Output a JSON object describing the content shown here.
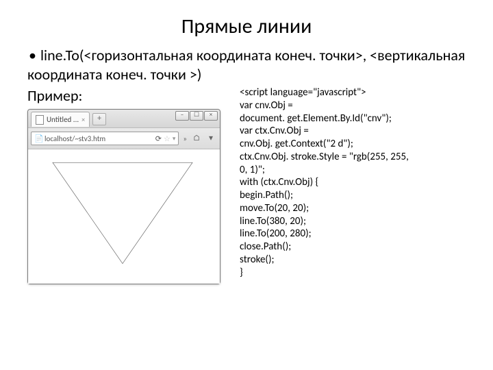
{
  "title": "Прямые линии",
  "bullet_text": "line.To(<горизонтальная координата конеч. точки>, <вертикальная координата конеч. точки >)",
  "example_label": "Пример:",
  "browser": {
    "tab_title": "Untitled ...",
    "tab_close": "×",
    "newtab": "+",
    "win_min": "–",
    "win_max": "☐",
    "win_close": "×",
    "url": "localhost/~stv3.htm",
    "reload": "⟳",
    "star": "☆",
    "hist": "▾",
    "chevrons": "»",
    "home": "⌂",
    "nav_down": "▾"
  },
  "code": {
    "l1": "<script language=\"javascript\">",
    "l2": "var cnv.Obj =",
    "l3": "document. get.Element.By.Id(\"cnv\");",
    "l4": "var ctx.Cnv.Obj =",
    "l5": "cnv.Obj. get.Context(\"2 d\");",
    "l6": "ctx.Cnv.Obj. stroke.Style = \"rgb(255, 255,",
    "l7": "0, 1)\";",
    "l8": "with (ctx.Cnv.Obj) {",
    "l9": "begin.Path();",
    "l10": "move.To(20, 20);",
    "l11": "line.To(380, 20);",
    "l12": "line.To(200, 280);",
    "l13": "close.Path();",
    "l14": "stroke();",
    "l15": "}"
  }
}
